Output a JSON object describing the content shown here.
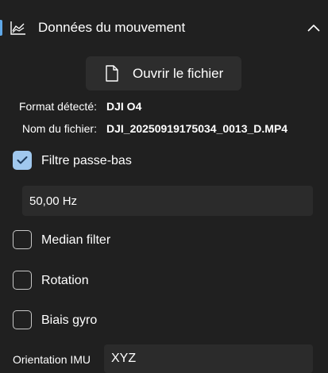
{
  "section": {
    "title": "Données du mouvement",
    "icon": "area-chart-icon",
    "collapse_icon": "chevron-up-icon",
    "accent_color": "#5fa8e8"
  },
  "open_file": {
    "label": "Ouvrir le fichier",
    "icon": "file-icon"
  },
  "info": {
    "format_label": "Format détecté:",
    "format_value": "DJI O4",
    "filename_label": "Nom du fichier:",
    "filename_value": "DJI_20250919175034_0013_D.MP4"
  },
  "lowpass": {
    "label": "Filtre passe-bas",
    "checked": true,
    "value": "50,00 Hz"
  },
  "median": {
    "label": "Median filter",
    "checked": false
  },
  "rotation": {
    "label": "Rotation",
    "checked": false
  },
  "gyro_bias": {
    "label": "Biais gyro",
    "checked": false
  },
  "imu": {
    "label": "Orientation IMU",
    "value": "XYZ"
  },
  "colors": {
    "background": "#202020",
    "checkbox_checked": "#a0c8ee",
    "field_background": "#2b2b2b"
  }
}
